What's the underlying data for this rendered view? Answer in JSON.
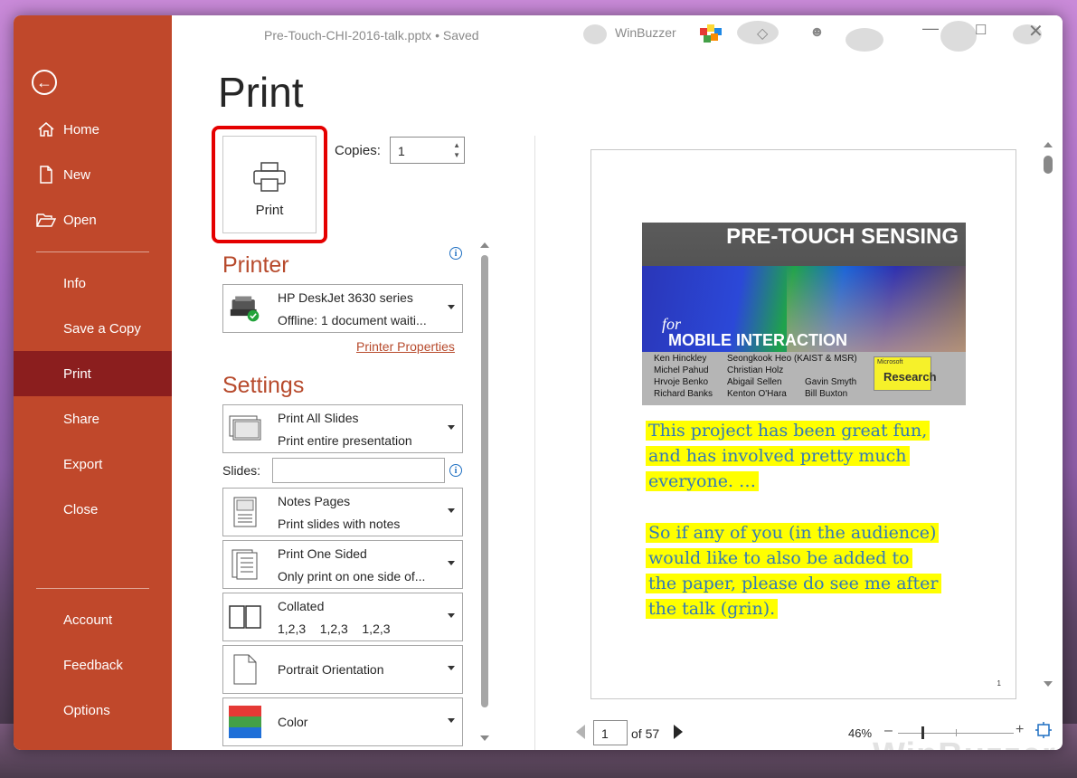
{
  "window": {
    "doc_title": "Pre-Touch-CHI-2016-talk.pptx • Saved",
    "user": "WinBuzzer"
  },
  "sidebar": {
    "items": [
      {
        "label": "Home"
      },
      {
        "label": "New"
      },
      {
        "label": "Open"
      },
      {
        "label": "Info"
      },
      {
        "label": "Save a Copy"
      },
      {
        "label": "Print"
      },
      {
        "label": "Share"
      },
      {
        "label": "Export"
      },
      {
        "label": "Close"
      },
      {
        "label": "Account"
      },
      {
        "label": "Feedback"
      },
      {
        "label": "Options"
      }
    ],
    "active": "Print",
    "accent": "#c0482b",
    "active_color": "#8b1e1e"
  },
  "main": {
    "title": "Print",
    "print_button": "Print",
    "copies_label": "Copies:",
    "copies_value": "1",
    "printer": {
      "section": "Printer",
      "name": "HP DeskJet 3630 series",
      "status": "Offline: 1 document waiti...",
      "properties_link": "Printer Properties"
    },
    "settings": {
      "section": "Settings",
      "range": {
        "l1": "Print All Slides",
        "l2": "Print entire presentation"
      },
      "slides_label": "Slides:",
      "slides_value": "",
      "layout": {
        "l1": "Notes Pages",
        "l2": "Print slides with notes"
      },
      "sides": {
        "l1": "Print One Sided",
        "l2": "Only print on one side of..."
      },
      "collate": {
        "l1": "Collated",
        "l2": "1,2,3    1,2,3    1,2,3"
      },
      "orientation": "Portrait Orientation",
      "color": "Color"
    }
  },
  "preview": {
    "slide_title": "PRE-TOUCH SENSING",
    "slide_for": "for",
    "slide_subtitle": "MOBILE INTERACTION",
    "authors": [
      "Ken Hinckley",
      "Seongkook Heo (KAIST & MSR)",
      "Michel Pahud",
      "Christian Holz",
      "Hrvoje Benko",
      "Abigail Sellen",
      "Gavin Smyth",
      "Richard Banks",
      "Kenton O'Hara",
      "Bill Buxton"
    ],
    "logo_small": "Microsoft",
    "logo_big": "Research",
    "notes_p1": [
      "This project has been great fun,",
      "and has involved pretty much",
      "everyone. …"
    ],
    "notes_p2": [
      "So if any of you (in the audience)",
      "would like to also be added to",
      "the paper, please do see me after",
      "the talk (grin)."
    ],
    "page_number": "1",
    "highlight_color": "#ffff00",
    "notes_color": "#337ab7"
  },
  "pager": {
    "current": "1",
    "of_text": "of 57"
  },
  "zoom": {
    "level": "46%"
  },
  "watermark": "WinBuzzer"
}
